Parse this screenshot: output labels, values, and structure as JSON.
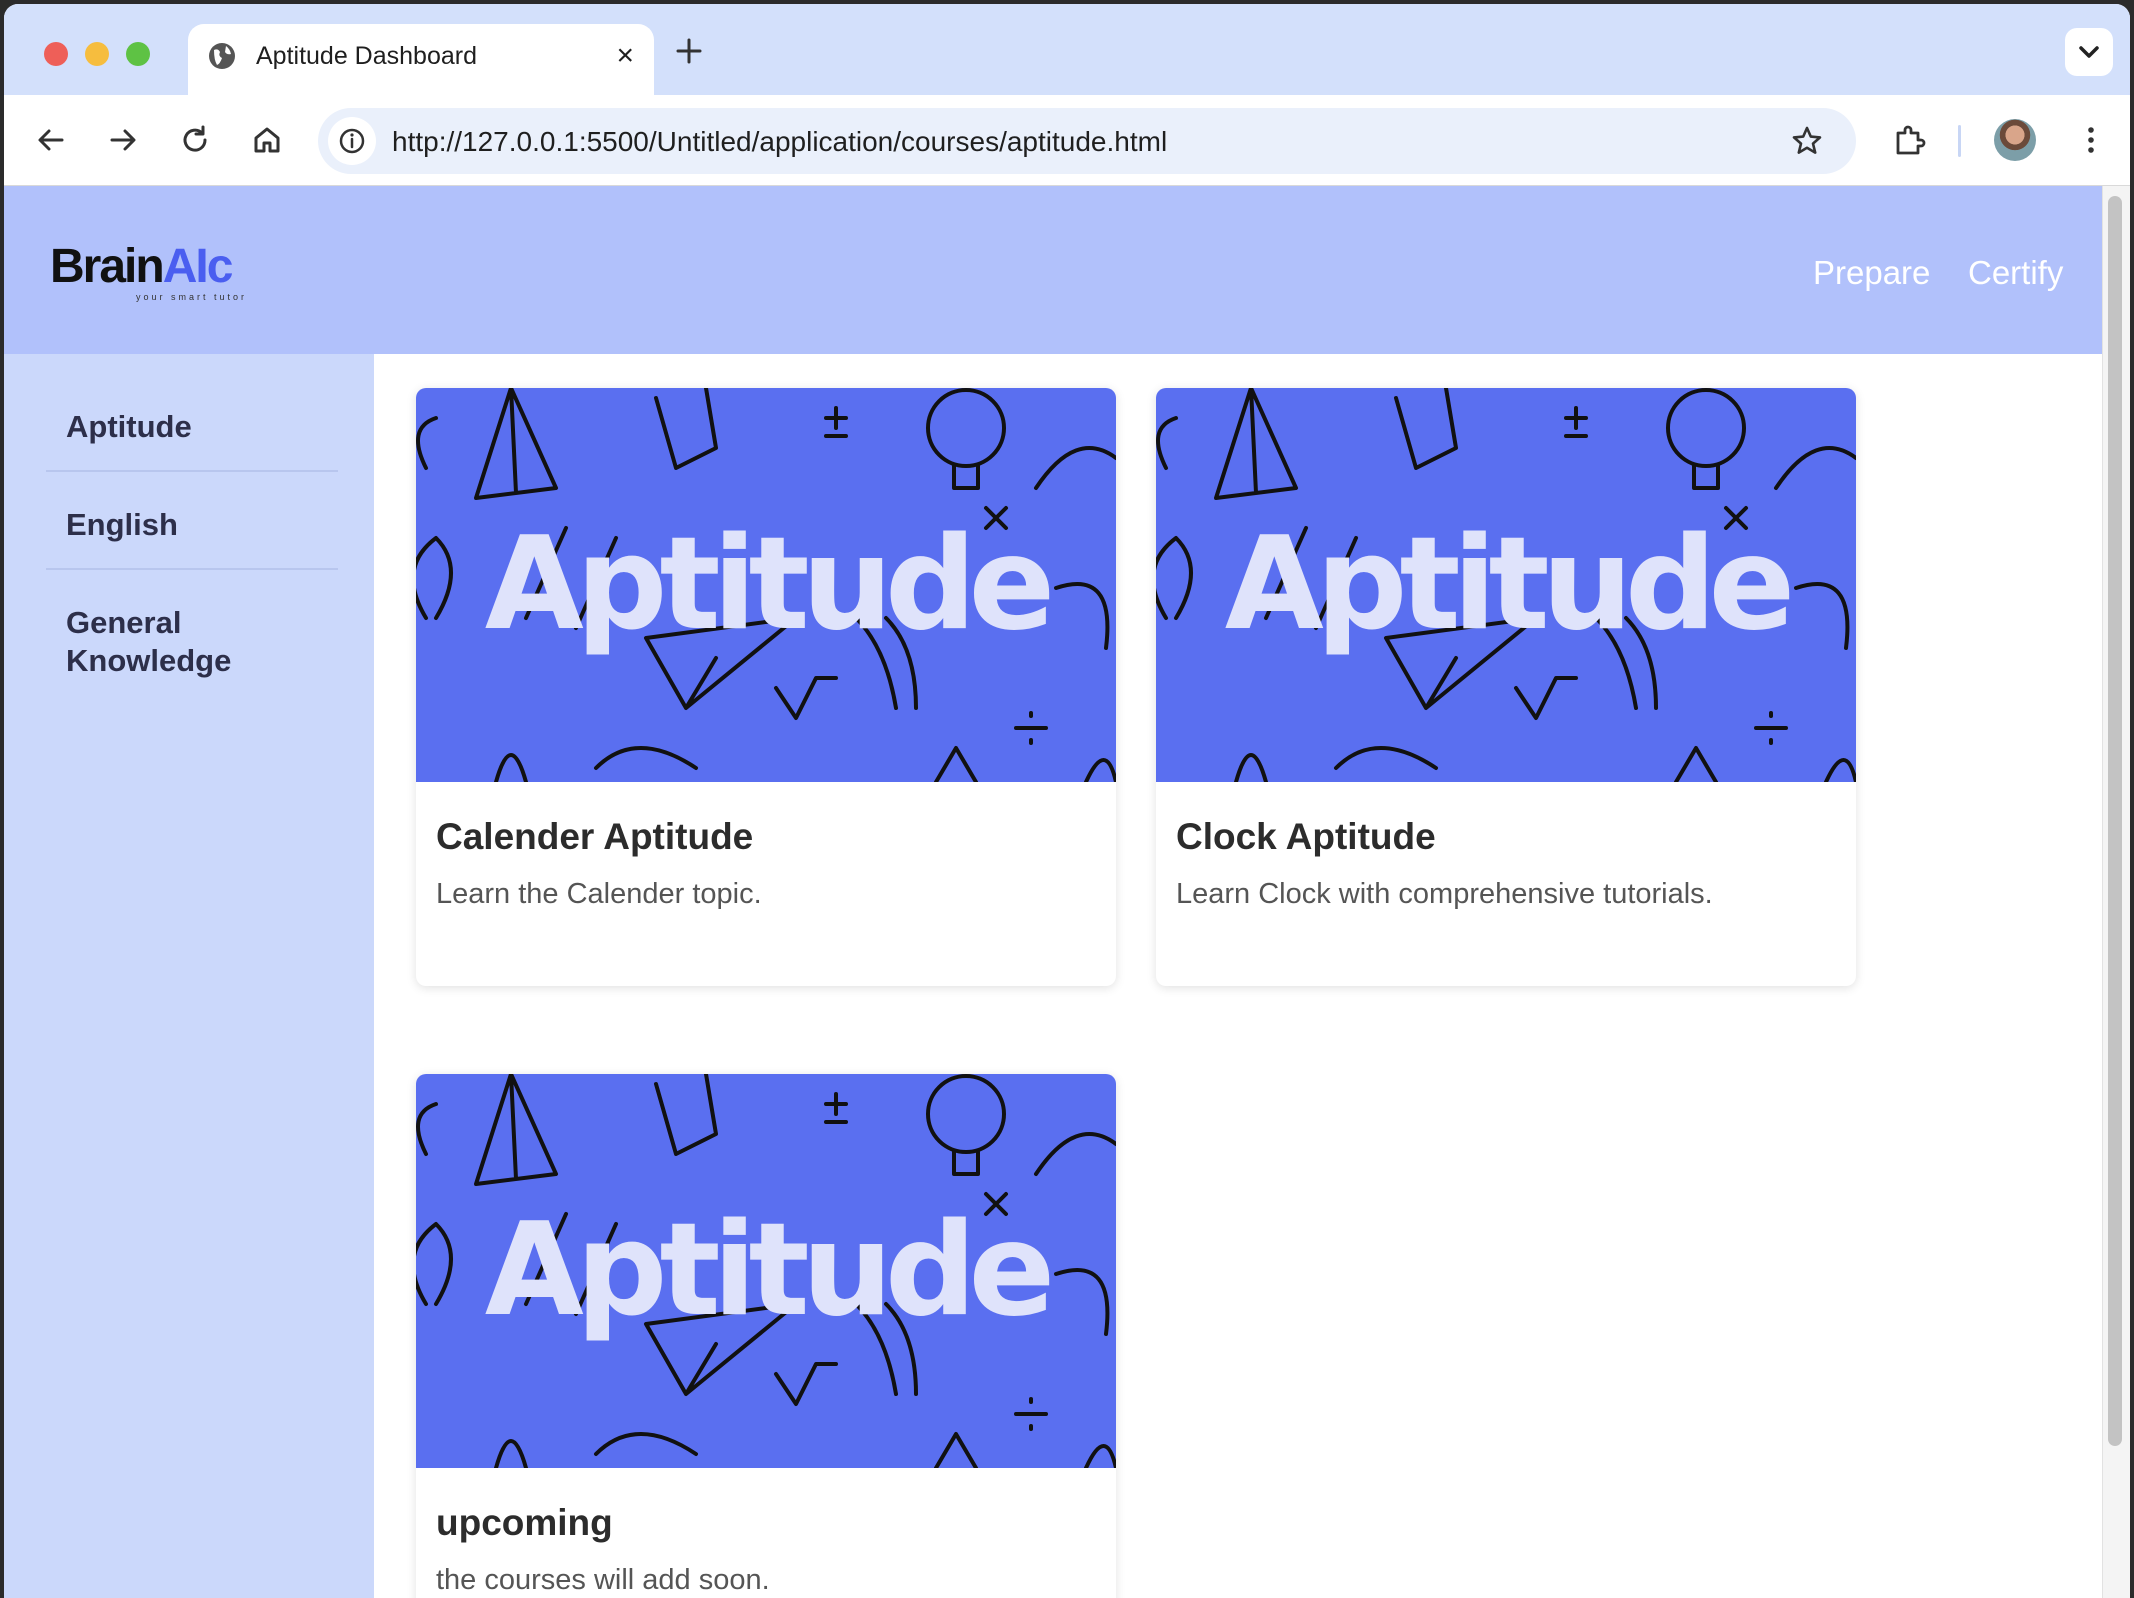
{
  "browser": {
    "tab": {
      "title": "Aptitude Dashboard"
    },
    "address_bar": {
      "url": "http://127.0.0.1:5500/Untitled/application/courses/aptitude.html"
    }
  },
  "site": {
    "logo": {
      "text_main": "Brain",
      "text_accent": "AIc",
      "tagline": "your smart tutor"
    },
    "nav": [
      {
        "label": "Prepare"
      },
      {
        "label": "Certify"
      }
    ]
  },
  "sidebar": {
    "items": [
      {
        "label": "Aptitude"
      },
      {
        "label": "English"
      },
      {
        "label": "General Knowledge"
      }
    ]
  },
  "courses": [
    {
      "banner_text": "Aptitude",
      "title": "Calender Aptitude",
      "description": "Learn the Calender topic."
    },
    {
      "banner_text": "Aptitude",
      "title": "Clock Aptitude",
      "description": "Learn Clock with comprehensive tutorials."
    },
    {
      "banner_text": "Aptitude",
      "title": "upcoming",
      "description": "the courses will add soon."
    }
  ],
  "colors": {
    "header_bg": "#b1c1fb",
    "sidebar_bg": "#cbd8fb",
    "banner_bg": "#5a6ff0",
    "logo_accent": "#4a5ef0"
  }
}
